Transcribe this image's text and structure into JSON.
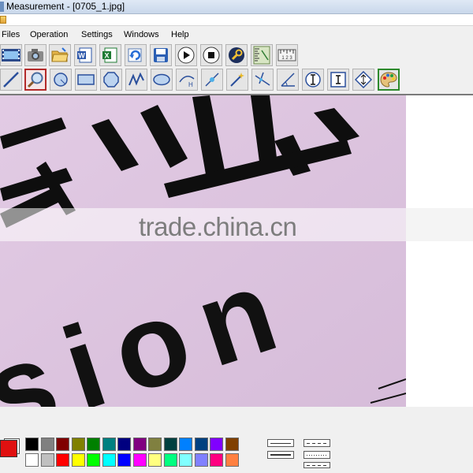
{
  "window": {
    "title": "Measurement - [0705_1.jpg]"
  },
  "menu": {
    "items": [
      "Files",
      "Operation",
      "Settings",
      "Windows",
      "Help"
    ]
  },
  "toolbar1": {
    "tools": [
      "video-capture-icon",
      "camera-icon",
      "open-folder-icon",
      "word-export-icon",
      "excel-export-icon",
      "refresh-icon",
      "save-icon",
      "play-icon",
      "stop-icon",
      "wrench-icon",
      "ruler-vertical-icon",
      "ruler-horizontal-icon"
    ]
  },
  "toolbar2": {
    "tools": [
      "line-tool-icon",
      "zoom-tool-icon",
      "circle-tool-icon",
      "rectangle-tool-icon",
      "polygon-tool-icon",
      "polyline-tool-icon",
      "ellipse-tool-icon",
      "height-arc-icon",
      "point-measure-icon",
      "wand-icon",
      "perpendicular-icon",
      "angle-icon",
      "vertical-caliper-icon",
      "horizontal-caliper-icon",
      "diamond-caliper-icon",
      "palette-icon"
    ]
  },
  "canvas": {
    "text_lines": [
      "专 业",
      "sion"
    ],
    "watermark": "trade.china.cn"
  },
  "palette": {
    "current_foreground": "#e01010",
    "current_background": "#ffffff",
    "row1": [
      "#000000",
      "#808080",
      "#800000",
      "#808000",
      "#008000",
      "#008080",
      "#000080",
      "#800080",
      "#808040",
      "#004040",
      "#0080ff",
      "#004080",
      "#8000ff",
      "#804000"
    ],
    "row2": [
      "#ffffff",
      "#c0c0c0",
      "#ff0000",
      "#ffff00",
      "#00ff00",
      "#00ffff",
      "#0000ff",
      "#ff00ff",
      "#ffff80",
      "#00ff80",
      "#80ffff",
      "#8080ff",
      "#ff0080",
      "#ff8040"
    ]
  },
  "line_styles": [
    "solid",
    "thick",
    "dash",
    "dot"
  ]
}
